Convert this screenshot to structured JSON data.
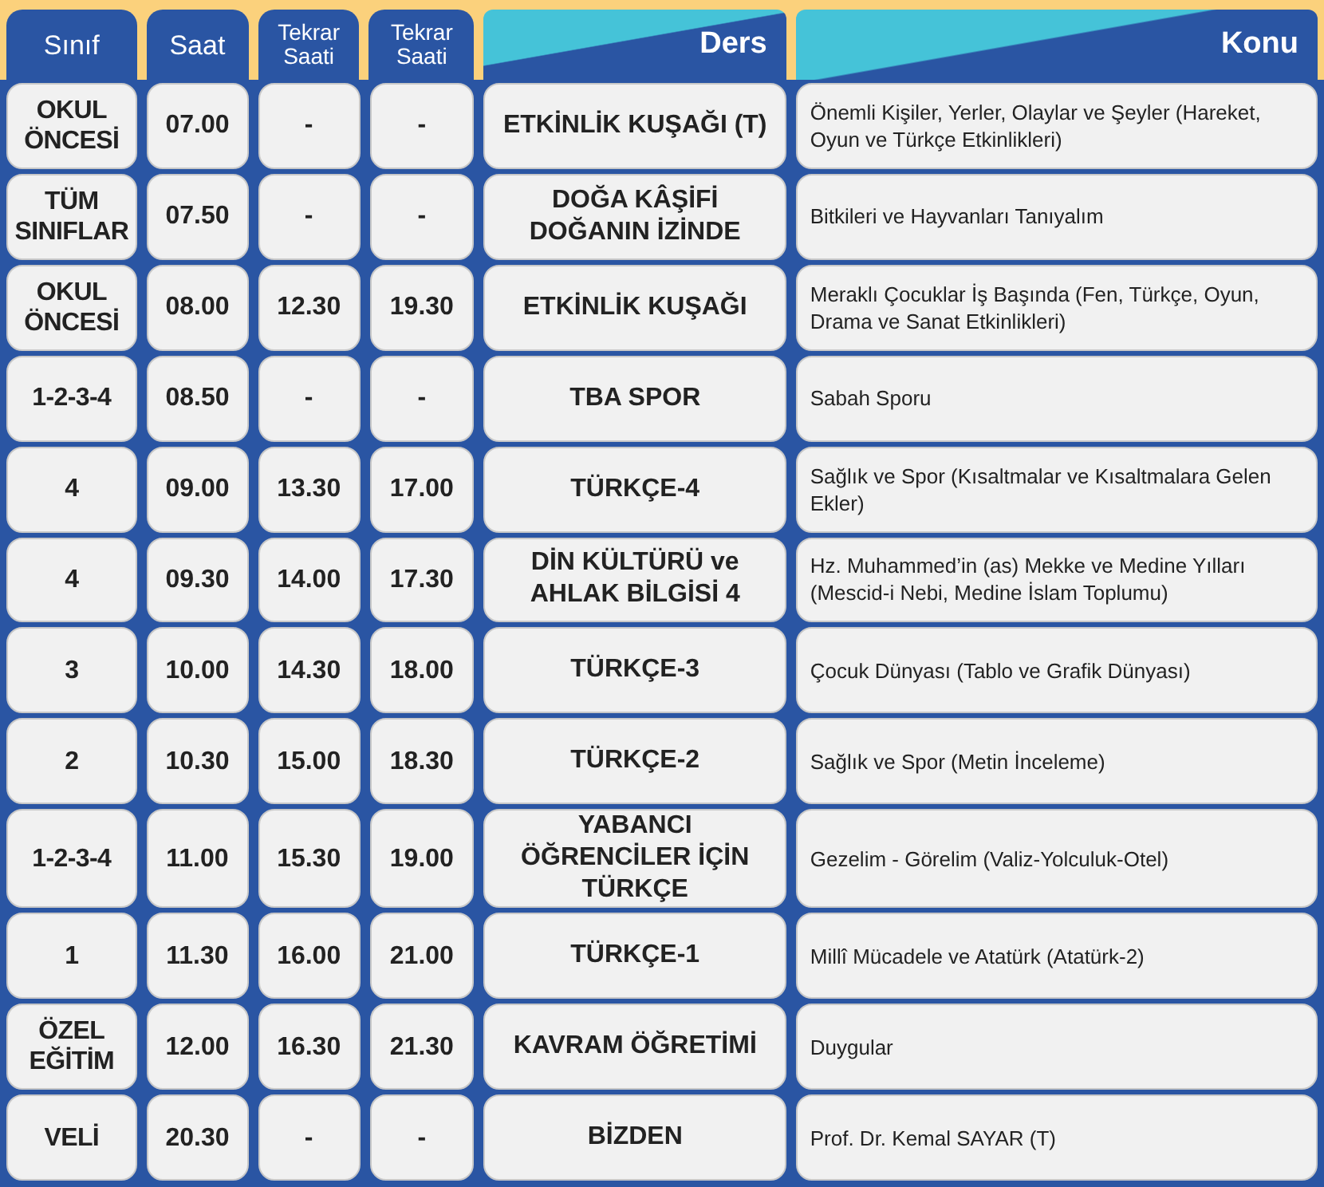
{
  "columns": [
    {
      "label": "Sınıf",
      "kind": "tab"
    },
    {
      "label": "Saat",
      "kind": "tab"
    },
    {
      "label": "Tekrar Saati",
      "kind": "tab"
    },
    {
      "label": "Tekrar Saati",
      "kind": "tab"
    },
    {
      "label": "Ders",
      "kind": "banner"
    },
    {
      "label": "Konu",
      "kind": "banner"
    }
  ],
  "rows": [
    {
      "sinif": "OKUL ÖNCESİ",
      "saat": "07.00",
      "tekrar_1": "-",
      "tekrar_2": "-",
      "ders": "ETKİNLİK KUŞAĞI (T)",
      "konu": "Önemli Kişiler, Yerler, Olaylar ve Şeyler (Hareket, Oyun ve Türkçe Etkinlikleri)"
    },
    {
      "sinif": "TÜM SINIFLAR",
      "saat": "07.50",
      "tekrar_1": "-",
      "tekrar_2": "-",
      "ders": "DOĞA KÂŞİFİ DOĞANIN İZİNDE",
      "konu": "Bitkileri ve Hayvanları Tanıyalım"
    },
    {
      "sinif": "OKUL ÖNCESİ",
      "saat": "08.00",
      "tekrar_1": "12.30",
      "tekrar_2": "19.30",
      "ders": "ETKİNLİK KUŞAĞI",
      "konu": "Meraklı Çocuklar İş Başında (Fen, Türkçe, Oyun, Drama ve Sanat Etkinlikleri)"
    },
    {
      "sinif": "1-2-3-4",
      "saat": "08.50",
      "tekrar_1": "-",
      "tekrar_2": "-",
      "ders": "TBA SPOR",
      "konu": "Sabah Sporu"
    },
    {
      "sinif": "4",
      "saat": "09.00",
      "tekrar_1": "13.30",
      "tekrar_2": "17.00",
      "ders": "TÜRKÇE-4",
      "konu": "Sağlık ve Spor (Kısaltmalar ve Kısaltmalara Gelen Ekler)"
    },
    {
      "sinif": "4",
      "saat": "09.30",
      "tekrar_1": "14.00",
      "tekrar_2": "17.30",
      "ders": "DİN KÜLTÜRÜ ve AHLAK BİLGİSİ 4",
      "konu": "Hz. Muhammed’in (as) Mekke ve Medine Yılları (Mescid-i Nebi, Medine İslam Toplumu)"
    },
    {
      "sinif": "3",
      "saat": "10.00",
      "tekrar_1": "14.30",
      "tekrar_2": "18.00",
      "ders": "TÜRKÇE-3",
      "konu": "Çocuk Dünyası (Tablo ve Grafik Dünyası)"
    },
    {
      "sinif": "2",
      "saat": "10.30",
      "tekrar_1": "15.00",
      "tekrar_2": "18.30",
      "ders": "TÜRKÇE-2",
      "konu": "Sağlık ve Spor (Metin İnceleme)"
    },
    {
      "sinif": "1-2-3-4",
      "saat": "11.00",
      "tekrar_1": "15.30",
      "tekrar_2": "19.00",
      "ders": "YABANCI ÖĞRENCİLER İÇİN TÜRKÇE",
      "konu": "Gezelim - Görelim (Valiz-Yolculuk-Otel)"
    },
    {
      "sinif": "1",
      "saat": "11.30",
      "tekrar_1": "16.00",
      "tekrar_2": "21.00",
      "ders": "TÜRKÇE-1",
      "konu": "Millî Mücadele ve Atatürk (Atatürk-2)"
    },
    {
      "sinif": "ÖZEL EĞİTİM",
      "saat": "12.00",
      "tekrar_1": "16.30",
      "tekrar_2": "21.30",
      "ders": "KAVRAM ÖĞRETİMİ",
      "konu": "Duygular"
    },
    {
      "sinif": "VELİ",
      "saat": "20.30",
      "tekrar_1": "-",
      "tekrar_2": "-",
      "ders": "BİZDEN",
      "konu": "Prof. Dr. Kemal SAYAR (T)"
    }
  ]
}
